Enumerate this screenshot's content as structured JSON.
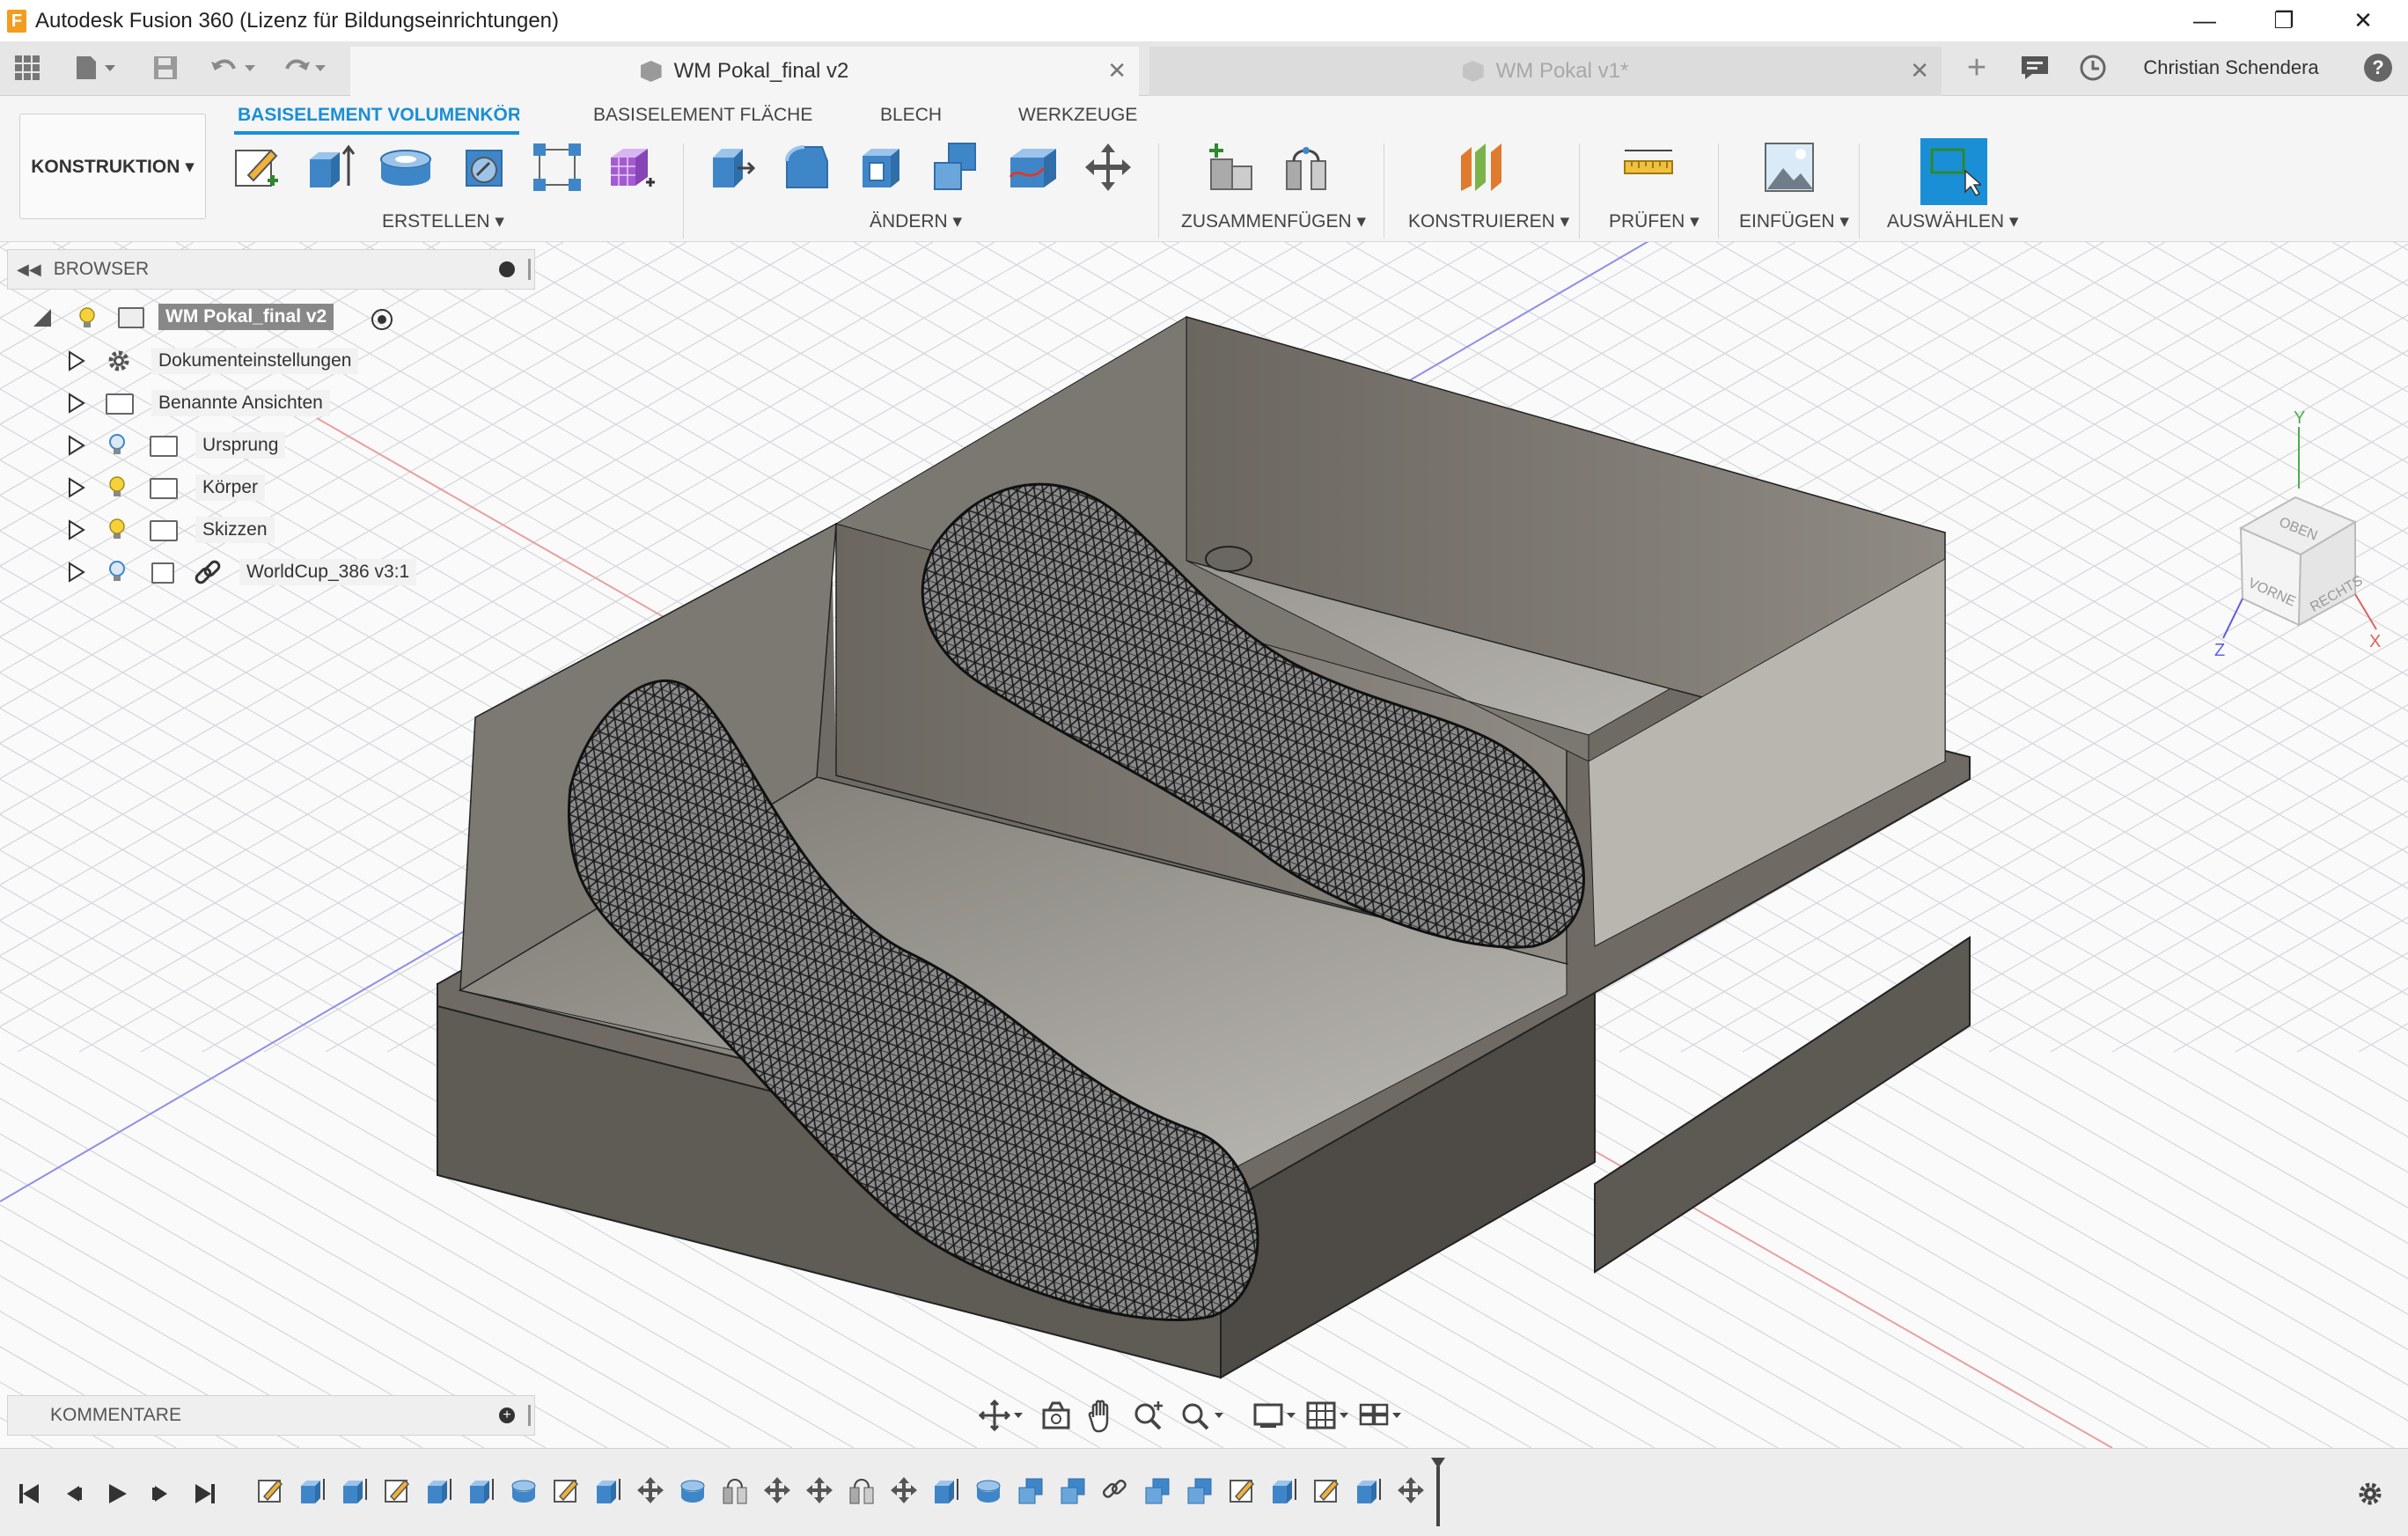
{
  "window": {
    "title": "Autodesk Fusion 360 (Lizenz für Bildungseinrichtungen)",
    "app_icon_letter": "F",
    "controls": {
      "minimize": "—",
      "restore": "❐",
      "close": "✕"
    }
  },
  "tabs": [
    {
      "label": "WM Pokal_final v2",
      "active": true,
      "close": "✕"
    },
    {
      "label": "WM Pokal v1*",
      "active": false,
      "close": "✕"
    }
  ],
  "tabbar": {
    "new_tab": "+",
    "user": "Christian Schendera",
    "help": "?"
  },
  "toolbar": {
    "workspace": "KONSTRUKTION ▾",
    "ribbon_tabs": [
      "BASISELEMENT VOLUMENKÖR...",
      "BASISELEMENT FLÄCHE",
      "BLECH",
      "WERKZEUGE"
    ],
    "groups": [
      "ERSTELLEN ▾",
      "ÄNDERN ▾",
      "ZUSAMMENFÜGEN ▾",
      "KONSTRUIEREN ▾",
      "PRÜFEN ▾",
      "EINFÜGEN ▾",
      "AUSWÄHLEN ▾"
    ]
  },
  "browser": {
    "title": "BROWSER",
    "root": "WM Pokal_final v2",
    "items": [
      {
        "label": "Dokumenteinstellungen",
        "icon": "gear-icon"
      },
      {
        "label": "Benannte Ansichten",
        "icon": "folder-icon"
      },
      {
        "label": "Ursprung",
        "icon": "folder-icon",
        "bulb": "blue"
      },
      {
        "label": "Körper",
        "icon": "folder-icon",
        "bulb": "yellow"
      },
      {
        "label": "Skizzen",
        "icon": "folder-icon",
        "bulb": "yellow"
      },
      {
        "label": "WorldCup_386 v3:1",
        "icon": "link-icon",
        "bulb": "blue"
      }
    ]
  },
  "comments": {
    "title": "KOMMENTARE"
  },
  "viewcube": {
    "top": "OBEN",
    "front": "VORNE",
    "right": "RECHTS",
    "axis_x": "X",
    "axis_y": "Y",
    "axis_z": "Z"
  },
  "colors": {
    "accent": "#1a8fd6",
    "select_tool": "#1a8fd6",
    "box_body": "#58554f",
    "mesh": "#1e1e1e"
  }
}
